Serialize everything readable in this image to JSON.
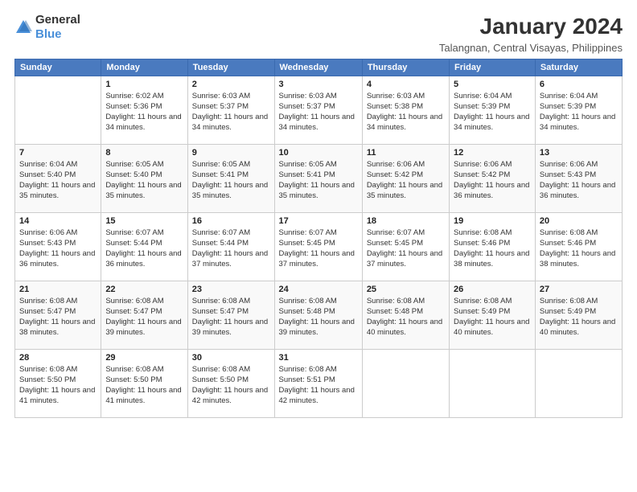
{
  "logo": {
    "general": "General",
    "blue": "Blue"
  },
  "title": "January 2024",
  "subtitle": "Talangnan, Central Visayas, Philippines",
  "days_header": [
    "Sunday",
    "Monday",
    "Tuesday",
    "Wednesday",
    "Thursday",
    "Friday",
    "Saturday"
  ],
  "weeks": [
    [
      {
        "day": "",
        "sunrise": "",
        "sunset": "",
        "daylight": ""
      },
      {
        "day": "1",
        "sunrise": "Sunrise: 6:02 AM",
        "sunset": "Sunset: 5:36 PM",
        "daylight": "Daylight: 11 hours and 34 minutes."
      },
      {
        "day": "2",
        "sunrise": "Sunrise: 6:03 AM",
        "sunset": "Sunset: 5:37 PM",
        "daylight": "Daylight: 11 hours and 34 minutes."
      },
      {
        "day": "3",
        "sunrise": "Sunrise: 6:03 AM",
        "sunset": "Sunset: 5:37 PM",
        "daylight": "Daylight: 11 hours and 34 minutes."
      },
      {
        "day": "4",
        "sunrise": "Sunrise: 6:03 AM",
        "sunset": "Sunset: 5:38 PM",
        "daylight": "Daylight: 11 hours and 34 minutes."
      },
      {
        "day": "5",
        "sunrise": "Sunrise: 6:04 AM",
        "sunset": "Sunset: 5:39 PM",
        "daylight": "Daylight: 11 hours and 34 minutes."
      },
      {
        "day": "6",
        "sunrise": "Sunrise: 6:04 AM",
        "sunset": "Sunset: 5:39 PM",
        "daylight": "Daylight: 11 hours and 34 minutes."
      }
    ],
    [
      {
        "day": "7",
        "sunrise": "Sunrise: 6:04 AM",
        "sunset": "Sunset: 5:40 PM",
        "daylight": "Daylight: 11 hours and 35 minutes."
      },
      {
        "day": "8",
        "sunrise": "Sunrise: 6:05 AM",
        "sunset": "Sunset: 5:40 PM",
        "daylight": "Daylight: 11 hours and 35 minutes."
      },
      {
        "day": "9",
        "sunrise": "Sunrise: 6:05 AM",
        "sunset": "Sunset: 5:41 PM",
        "daylight": "Daylight: 11 hours and 35 minutes."
      },
      {
        "day": "10",
        "sunrise": "Sunrise: 6:05 AM",
        "sunset": "Sunset: 5:41 PM",
        "daylight": "Daylight: 11 hours and 35 minutes."
      },
      {
        "day": "11",
        "sunrise": "Sunrise: 6:06 AM",
        "sunset": "Sunset: 5:42 PM",
        "daylight": "Daylight: 11 hours and 35 minutes."
      },
      {
        "day": "12",
        "sunrise": "Sunrise: 6:06 AM",
        "sunset": "Sunset: 5:42 PM",
        "daylight": "Daylight: 11 hours and 36 minutes."
      },
      {
        "day": "13",
        "sunrise": "Sunrise: 6:06 AM",
        "sunset": "Sunset: 5:43 PM",
        "daylight": "Daylight: 11 hours and 36 minutes."
      }
    ],
    [
      {
        "day": "14",
        "sunrise": "Sunrise: 6:06 AM",
        "sunset": "Sunset: 5:43 PM",
        "daylight": "Daylight: 11 hours and 36 minutes."
      },
      {
        "day": "15",
        "sunrise": "Sunrise: 6:07 AM",
        "sunset": "Sunset: 5:44 PM",
        "daylight": "Daylight: 11 hours and 36 minutes."
      },
      {
        "day": "16",
        "sunrise": "Sunrise: 6:07 AM",
        "sunset": "Sunset: 5:44 PM",
        "daylight": "Daylight: 11 hours and 37 minutes."
      },
      {
        "day": "17",
        "sunrise": "Sunrise: 6:07 AM",
        "sunset": "Sunset: 5:45 PM",
        "daylight": "Daylight: 11 hours and 37 minutes."
      },
      {
        "day": "18",
        "sunrise": "Sunrise: 6:07 AM",
        "sunset": "Sunset: 5:45 PM",
        "daylight": "Daylight: 11 hours and 37 minutes."
      },
      {
        "day": "19",
        "sunrise": "Sunrise: 6:08 AM",
        "sunset": "Sunset: 5:46 PM",
        "daylight": "Daylight: 11 hours and 38 minutes."
      },
      {
        "day": "20",
        "sunrise": "Sunrise: 6:08 AM",
        "sunset": "Sunset: 5:46 PM",
        "daylight": "Daylight: 11 hours and 38 minutes."
      }
    ],
    [
      {
        "day": "21",
        "sunrise": "Sunrise: 6:08 AM",
        "sunset": "Sunset: 5:47 PM",
        "daylight": "Daylight: 11 hours and 38 minutes."
      },
      {
        "day": "22",
        "sunrise": "Sunrise: 6:08 AM",
        "sunset": "Sunset: 5:47 PM",
        "daylight": "Daylight: 11 hours and 39 minutes."
      },
      {
        "day": "23",
        "sunrise": "Sunrise: 6:08 AM",
        "sunset": "Sunset: 5:47 PM",
        "daylight": "Daylight: 11 hours and 39 minutes."
      },
      {
        "day": "24",
        "sunrise": "Sunrise: 6:08 AM",
        "sunset": "Sunset: 5:48 PM",
        "daylight": "Daylight: 11 hours and 39 minutes."
      },
      {
        "day": "25",
        "sunrise": "Sunrise: 6:08 AM",
        "sunset": "Sunset: 5:48 PM",
        "daylight": "Daylight: 11 hours and 40 minutes."
      },
      {
        "day": "26",
        "sunrise": "Sunrise: 6:08 AM",
        "sunset": "Sunset: 5:49 PM",
        "daylight": "Daylight: 11 hours and 40 minutes."
      },
      {
        "day": "27",
        "sunrise": "Sunrise: 6:08 AM",
        "sunset": "Sunset: 5:49 PM",
        "daylight": "Daylight: 11 hours and 40 minutes."
      }
    ],
    [
      {
        "day": "28",
        "sunrise": "Sunrise: 6:08 AM",
        "sunset": "Sunset: 5:50 PM",
        "daylight": "Daylight: 11 hours and 41 minutes."
      },
      {
        "day": "29",
        "sunrise": "Sunrise: 6:08 AM",
        "sunset": "Sunset: 5:50 PM",
        "daylight": "Daylight: 11 hours and 41 minutes."
      },
      {
        "day": "30",
        "sunrise": "Sunrise: 6:08 AM",
        "sunset": "Sunset: 5:50 PM",
        "daylight": "Daylight: 11 hours and 42 minutes."
      },
      {
        "day": "31",
        "sunrise": "Sunrise: 6:08 AM",
        "sunset": "Sunset: 5:51 PM",
        "daylight": "Daylight: 11 hours and 42 minutes."
      },
      {
        "day": "",
        "sunrise": "",
        "sunset": "",
        "daylight": ""
      },
      {
        "day": "",
        "sunrise": "",
        "sunset": "",
        "daylight": ""
      },
      {
        "day": "",
        "sunrise": "",
        "sunset": "",
        "daylight": ""
      }
    ]
  ]
}
